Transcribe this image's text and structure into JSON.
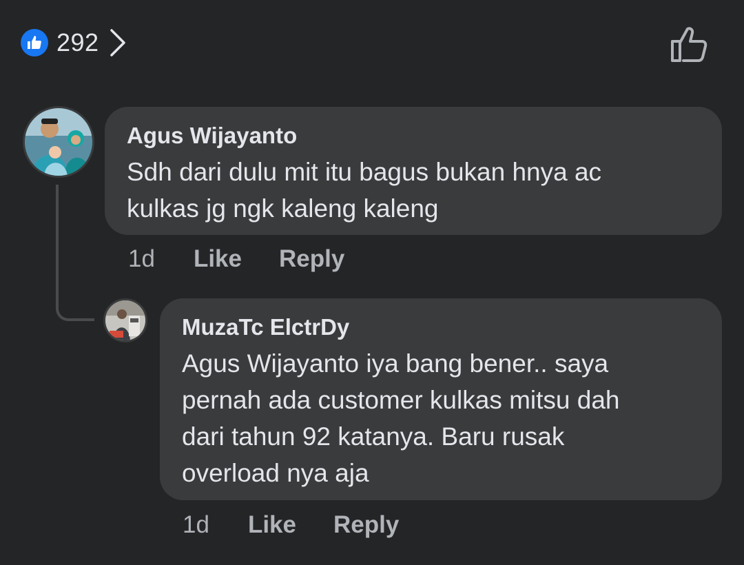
{
  "reactions": {
    "count": "292",
    "like_icon": "thumbs-up-icon",
    "chevron_icon": "chevron-right-icon",
    "like_action_icon": "thumbs-up-outline-icon",
    "badge_color": "#1877f2"
  },
  "comments": [
    {
      "author": "Agus Wijayanto",
      "text": "Sdh dari dulu mit itu bagus bukan hnya ac\nkulkas jg ngk kaleng kaleng",
      "time": "1d",
      "like_label": "Like",
      "reply_label": "Reply"
    },
    {
      "author": "MuzaTc ElctrDy",
      "text": "Agus Wijayanto iya bang bener.. saya\npernah ada customer kulkas mitsu dah\ndari tahun 92 katanya.  Baru rusak\noverload nya aja",
      "time": "1d",
      "like_label": "Like",
      "reply_label": "Reply"
    }
  ]
}
